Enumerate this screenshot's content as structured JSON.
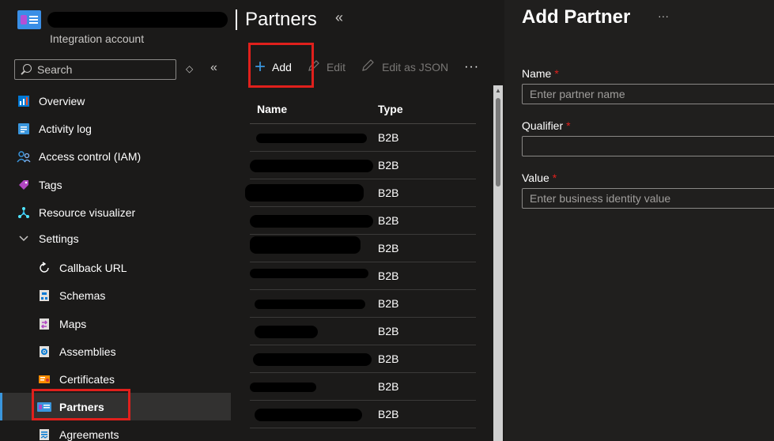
{
  "header": {
    "page_title": "Partners",
    "subtitle": "Integration account",
    "collapse_glyph": "«"
  },
  "nav": {
    "search_placeholder": "Search",
    "updown_glyph": "◇",
    "collapse_glyph": "«",
    "items": [
      {
        "label": "Overview",
        "icon": "overview-icon",
        "level": 1
      },
      {
        "label": "Activity log",
        "icon": "activity-log-icon",
        "level": 1
      },
      {
        "label": "Access control (IAM)",
        "icon": "people-icon",
        "level": 1
      },
      {
        "label": "Tags",
        "icon": "tag-icon",
        "level": 1
      },
      {
        "label": "Resource visualizer",
        "icon": "visualizer-icon",
        "level": 1
      },
      {
        "label": "Settings",
        "icon": "chevron-down-icon",
        "level": 1
      },
      {
        "label": "Callback URL",
        "icon": "refresh-icon",
        "level": 2
      },
      {
        "label": "Schemas",
        "icon": "schema-icon",
        "level": 2
      },
      {
        "label": "Maps",
        "icon": "map-icon",
        "level": 2
      },
      {
        "label": "Assemblies",
        "icon": "assembly-icon",
        "level": 2
      },
      {
        "label": "Certificates",
        "icon": "certificate-icon",
        "level": 2
      },
      {
        "label": "Partners",
        "icon": "partner-icon",
        "level": 2,
        "selected": true
      },
      {
        "label": "Agreements",
        "icon": "agreement-icon",
        "level": 2
      }
    ]
  },
  "toolbar": {
    "add_label": "Add",
    "edit_label": "Edit",
    "edit_json_label": "Edit as JSON",
    "more_label": "···"
  },
  "grid": {
    "columns": [
      "Name",
      "Type"
    ],
    "rows": [
      {
        "type": "B2B"
      },
      {
        "type": "B2B"
      },
      {
        "type": "B2B"
      },
      {
        "type": "B2B"
      },
      {
        "type": "B2B"
      },
      {
        "type": "B2B"
      },
      {
        "type": "B2B"
      },
      {
        "type": "B2B"
      },
      {
        "type": "B2B"
      },
      {
        "type": "B2B"
      },
      {
        "type": "B2B"
      }
    ]
  },
  "panel": {
    "title": "Add Partner",
    "more_label": "···",
    "name_label": "Name",
    "name_placeholder": "Enter partner name",
    "qualifier_label": "Qualifier",
    "value_label": "Value",
    "value_placeholder": "Enter business identity value",
    "required_mark": "*"
  },
  "colors": {
    "accent": "#3a96dd",
    "highlight_box": "#e0201c",
    "required": "#e0201c"
  }
}
